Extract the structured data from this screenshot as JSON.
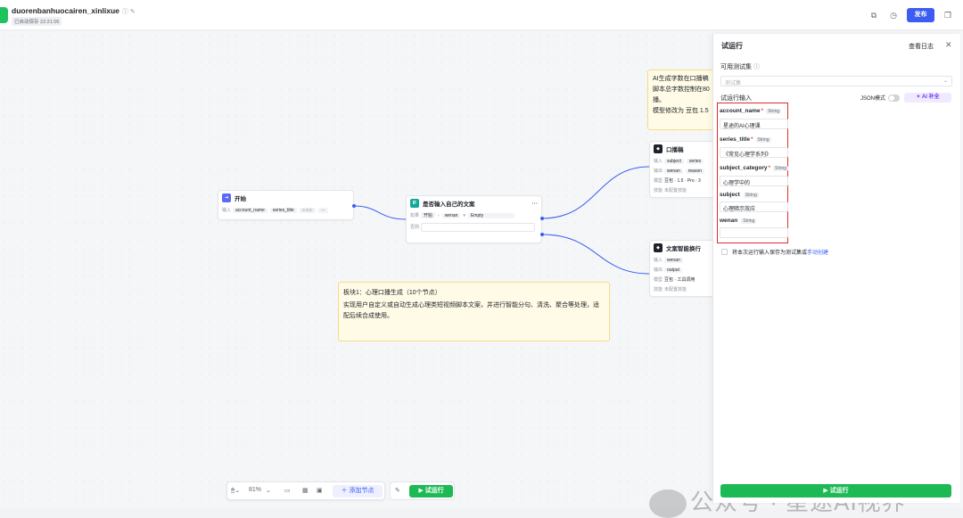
{
  "header": {
    "title": "duorenbanhuocairen_xinlixue",
    "title_icons": "ⓘ ✎",
    "save_status": "已自动保存 22:21:05",
    "publish_label": "发布"
  },
  "canvas": {
    "start_node": {
      "title": "开始",
      "row_label": "输入",
      "params": [
        "account_name",
        "series_title",
        "subje"
      ],
      "more": "···"
    },
    "if_node": {
      "title": "是否输入自己的文案",
      "badge": "IF",
      "menu": "···",
      "if_label": "如果",
      "if_var1": "开始",
      "if_var2": "wenan",
      "if_op": "Empty",
      "else_label": "否则"
    },
    "kb_node": {
      "title": "口播稿",
      "input_label": "输入",
      "input_params": [
        "subject",
        "series"
      ],
      "output_label": "输出",
      "output_params": [
        "wenan",
        "reason"
      ],
      "model_label": "模型",
      "model_value": "豆包 · 1.5 · Pro · 3",
      "skill_label": "技能",
      "skill_value": "未配置技能"
    },
    "split_node": {
      "title": "文案智能换行",
      "input_label": "输入",
      "input_params": [
        "wenan"
      ],
      "output_label": "输出",
      "output_params": [
        "output"
      ],
      "model_label": "模型",
      "model_value": "豆包 · 工具调用",
      "skill_label": "技能",
      "skill_value": "未配置技能"
    },
    "note_top": {
      "lines": [
        "AI生成字数在口播稿",
        "脚本总字数控制在80",
        "播。",
        "模型修改为 豆包 1.5"
      ]
    },
    "note_main": {
      "title": "板块1：心理口播生成（10个节点）",
      "body": "实现用户自定义或自动生成心理类短视频脚本文案，并进行智能分句、清洗、聚合等处理，适配后续合成使用。"
    }
  },
  "panel": {
    "title": "试运行",
    "view_log": "查看日志",
    "close": "✕",
    "testset_label": "可用测试集",
    "testset_hint": "ⓘ",
    "testset_placeholder": "测试集",
    "input_label": "试运行输入",
    "json_mode_label": "JSON模式",
    "ai_fill_label": "✦ AI 补全",
    "fields": [
      {
        "name": "account_name",
        "required": "*",
        "type": "String",
        "value": "星途的AI心理课"
      },
      {
        "name": "series_title",
        "required": "*",
        "type": "String",
        "value": "《常见心理学系列》"
      },
      {
        "name": "subject_category",
        "required": "*",
        "type": "String",
        "value": "心理学中的"
      },
      {
        "name": "subject",
        "required": "",
        "type": "String",
        "value": "心理暗示效应"
      },
      {
        "name": "wenan",
        "required": "",
        "type": "String",
        "value": ""
      }
    ],
    "save_checkbox_text": "将本次运行输入保存为测试集或",
    "save_checkbox_link": "手动创建",
    "run_label": "▶ 试运行"
  },
  "bottom": {
    "zoom": "81%",
    "add_node_label": "＋ 添加节点",
    "run_label": "▶ 试运行"
  },
  "watermark": "公众号 · 星途AI视界",
  "colors": {
    "accent": "#3c5cf2",
    "run_green": "#1db954",
    "highlight_red": "#e02b2b",
    "note_bg": "#fffbe6"
  }
}
